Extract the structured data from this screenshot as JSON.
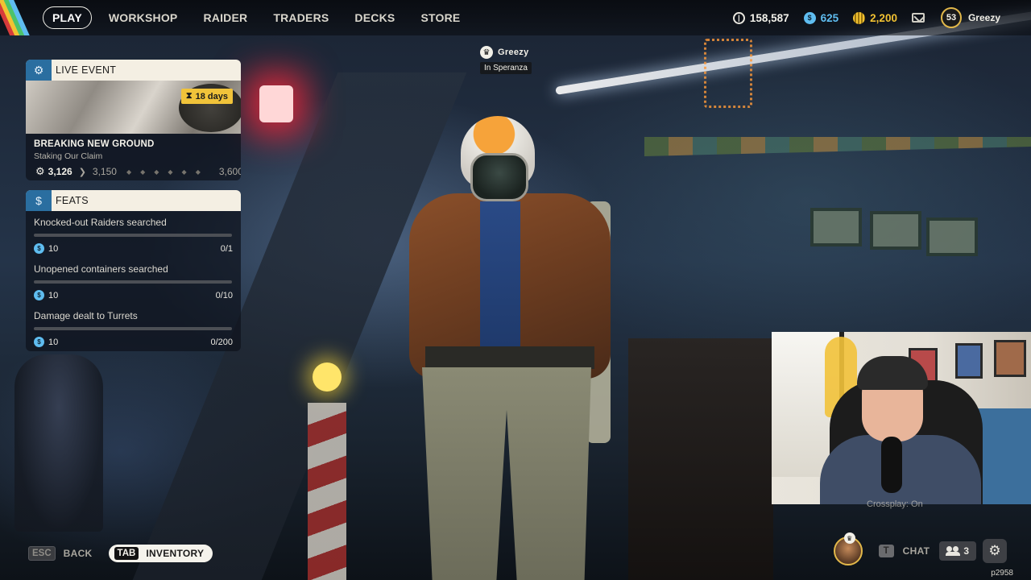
{
  "nav": {
    "items": [
      {
        "label": "PLAY",
        "active": true
      },
      {
        "label": "WORKSHOP",
        "active": false
      },
      {
        "label": "RAIDER",
        "active": false
      },
      {
        "label": "TRADERS",
        "active": false
      },
      {
        "label": "DECKS",
        "active": false
      },
      {
        "label": "STORE",
        "active": false
      }
    ]
  },
  "currencies": {
    "coins": "158,587",
    "tokens": "625",
    "gold": "2,200"
  },
  "profile": {
    "level": "53",
    "name": "Greezy"
  },
  "player_tag": {
    "name": "Greezy",
    "location": "In Speranza"
  },
  "live_event": {
    "header": "LIVE EVENT",
    "days_left": "18 days",
    "title": "BREAKING NEW GROUND",
    "subtitle": "Staking Our Claim",
    "current": "3,126",
    "next": "3,150",
    "max": "3,600"
  },
  "feats": {
    "header": "FEATS",
    "items": [
      {
        "title": "Knocked-out Raiders searched",
        "reward": "10",
        "progress": "0/1",
        "fraction": 0
      },
      {
        "title": "Unopened containers searched",
        "reward": "10",
        "progress": "0/10",
        "fraction": 0
      },
      {
        "title": "Damage dealt to Turrets",
        "reward": "10",
        "progress": "0/200",
        "fraction": 0
      }
    ]
  },
  "webcam": {
    "caption": "Crossplay: On"
  },
  "bottom": {
    "esc_key": "ESC",
    "back_label": "BACK",
    "tab_key": "TAB",
    "inventory_label": "INVENTORY",
    "t_key": "T",
    "chat_label": "CHAT",
    "friends_count": "3",
    "build_id": "p2958"
  },
  "colors": {
    "accent_blue": "#5fbdf0",
    "gold": "#f2c232",
    "panel_header": "#f4efe3"
  },
  "icons": {
    "settings": "gear-icon",
    "coins": "coin-icon",
    "mail": "mail-icon",
    "crown": "crown-icon",
    "friends": "friends-icon"
  }
}
